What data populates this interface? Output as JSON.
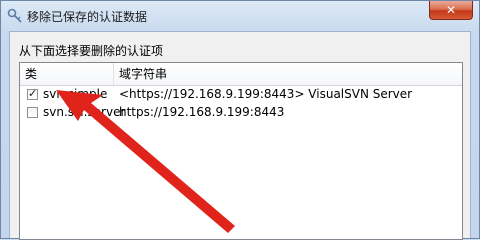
{
  "window": {
    "title": "移除已保存的认证数据",
    "close_symbol": "✕"
  },
  "dialog": {
    "instruction": "从下面选择要删除的认证项"
  },
  "list": {
    "columns": [
      "类",
      "域字符串"
    ],
    "rows": [
      {
        "checked": true,
        "type": "svn.simple",
        "domain": "<https://192.168.9.199:8443> VisualSVN Server"
      },
      {
        "checked": false,
        "type": "svn.ssl.server",
        "domain": "https://192.168.9.199:8443"
      }
    ]
  },
  "annotation": {
    "color": "#e0231b",
    "icon": "red-arrow-icon"
  },
  "colors": {
    "close_button": "#c4381a",
    "title_bar": "#c7d9ee"
  }
}
